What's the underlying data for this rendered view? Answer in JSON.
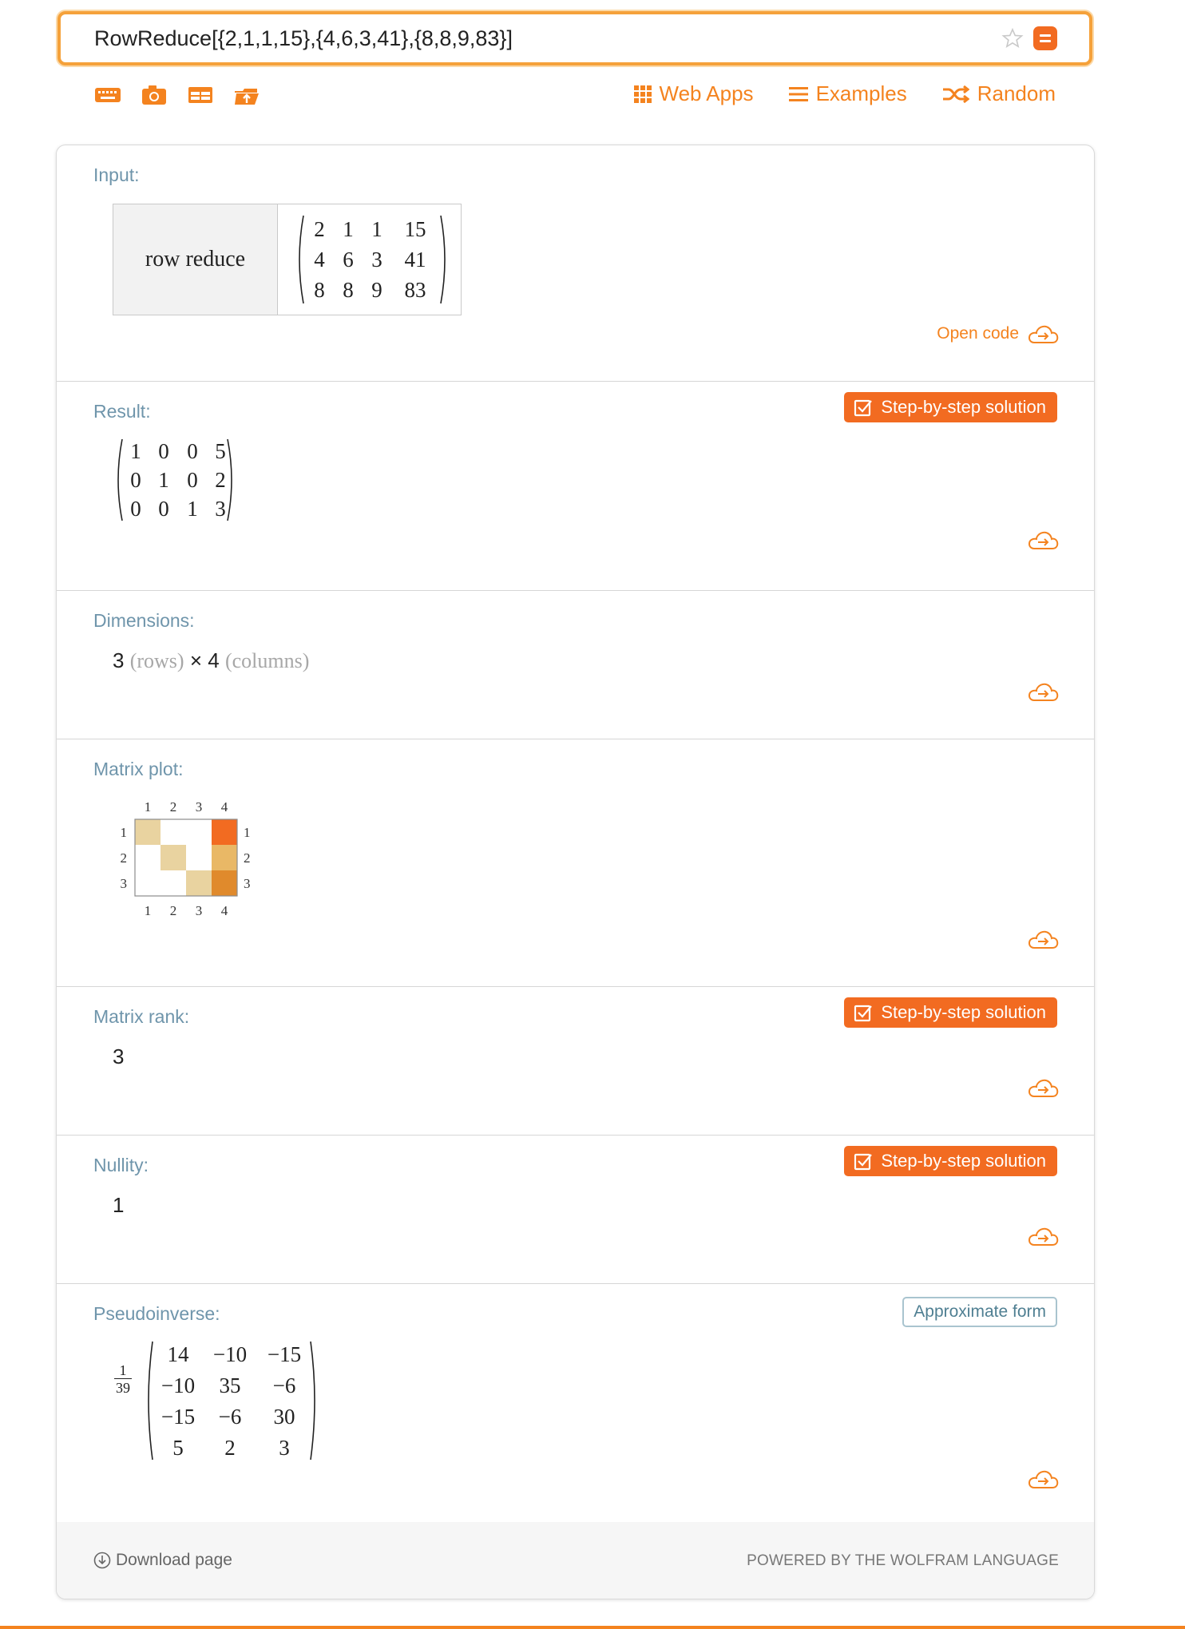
{
  "search": {
    "query": "RowReduce[{2,1,1,15},{4,6,3,41},{8,8,9,83}]"
  },
  "nav": {
    "web_apps": "Web Apps",
    "examples": "Examples",
    "random": "Random"
  },
  "pods": {
    "input": {
      "title": "Input:",
      "label": "row reduce",
      "matrix": [
        [
          "2",
          "1",
          "1",
          "15"
        ],
        [
          "4",
          "6",
          "3",
          "41"
        ],
        [
          "8",
          "8",
          "9",
          "83"
        ]
      ],
      "open_code": "Open code"
    },
    "result": {
      "title": "Result:",
      "step_label": "Step-by-step solution",
      "matrix": [
        [
          "1",
          "0",
          "0",
          "5"
        ],
        [
          "0",
          "1",
          "0",
          "2"
        ],
        [
          "0",
          "0",
          "1",
          "3"
        ]
      ]
    },
    "dimensions": {
      "title": "Dimensions:",
      "rows": "3",
      "rows_label": "(rows)",
      "times": "×",
      "cols": "4",
      "cols_label": "(columns)"
    },
    "matrix_plot": {
      "title": "Matrix plot:",
      "col_ticks": [
        "1",
        "2",
        "3",
        "4"
      ],
      "row_ticks": [
        "1",
        "2",
        "3"
      ],
      "cells": [
        [
          "#e9d3a0",
          "#ffffff",
          "#ffffff",
          "#f26b21"
        ],
        [
          "#ffffff",
          "#e9d3a0",
          "#ffffff",
          "#e9b866"
        ],
        [
          "#ffffff",
          "#ffffff",
          "#e9d3a0",
          "#e08a2c"
        ]
      ]
    },
    "rank": {
      "title": "Matrix rank:",
      "step_label": "Step-by-step solution",
      "value": "3"
    },
    "nullity": {
      "title": "Nullity:",
      "step_label": "Step-by-step solution",
      "value": "1"
    },
    "pseudoinverse": {
      "title": "Pseudoinverse:",
      "approx_label": "Approximate form",
      "fraction_num": "1",
      "fraction_den": "39",
      "matrix": [
        [
          "14",
          "−10",
          "−15"
        ],
        [
          "−10",
          "35",
          "−6"
        ],
        [
          "−15",
          "−6",
          "30"
        ],
        [
          "5",
          "2",
          "3"
        ]
      ]
    }
  },
  "footer": {
    "download": "Download page",
    "powered": "POWERED BY THE WOLFRAM LANGUAGE"
  },
  "colors": {
    "accent": "#f4831f",
    "button": "#f26b21",
    "pod_title": "#6f95ab"
  }
}
